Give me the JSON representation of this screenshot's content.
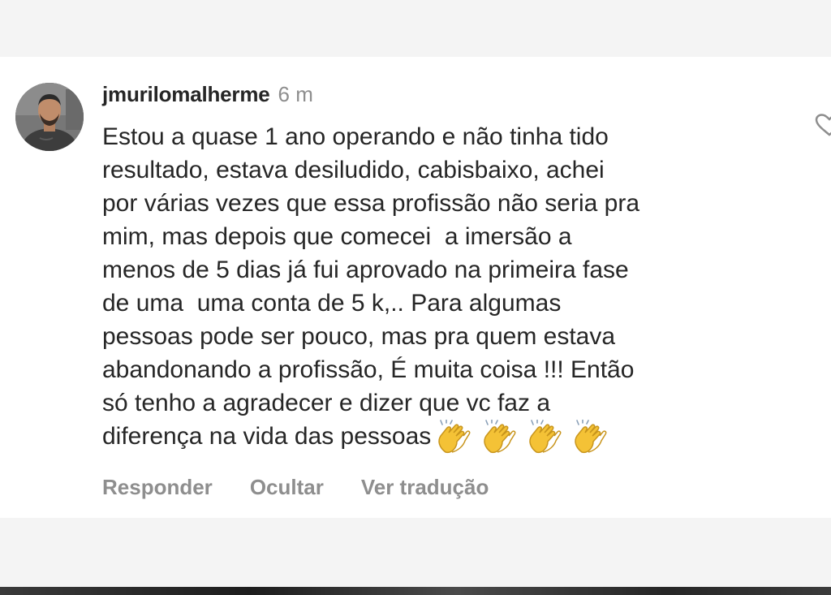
{
  "comment": {
    "username": "jmurilomalherme",
    "time": "6 m",
    "lines": [
      "Estou a quase 1 ano operando e não tinha tido",
      "resultado, estava desiludido, cabisbaixo, achei",
      "por várias vezes que essa profissão não seria pra",
      "mim, mas depois que comecei  a imersão a",
      "menos de 5 dias já fui aprovado na primeira fase",
      "de uma  uma conta de 5 k,.. Para algumas",
      "pessoas pode ser pouco, mas pra quem estava",
      "abandonando a profissão, É muita coisa !!! Então",
      "só tenho a agradecer e dizer que vc faz a",
      "diferença na vida das pessoas"
    ],
    "emoji_icon": "clapping-hands-icon",
    "emoji_count": 4
  },
  "actions": {
    "reply": "Responder",
    "hide": "Ocultar",
    "translate": "Ver tradução"
  },
  "icons": {
    "like": "heart-outline-icon",
    "avatar": "profile-avatar"
  },
  "colors": {
    "text": "#262626",
    "muted": "#8e8e8e",
    "card": "#ffffff",
    "background": "#f4f4f4",
    "emoji": "#f4c236"
  }
}
